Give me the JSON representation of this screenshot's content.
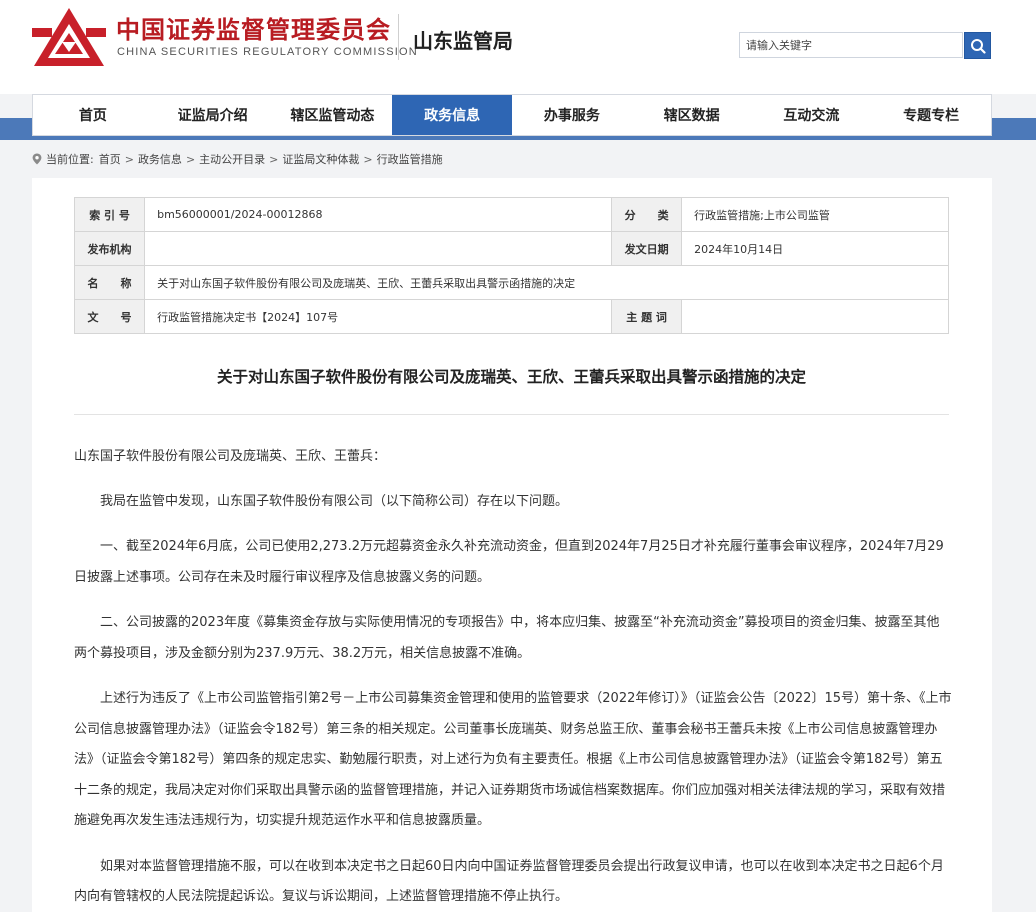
{
  "header": {
    "org_cn": "中国证券监督管理委员会",
    "org_en": "CHINA SECURITIES REGULATORY COMMISSION",
    "bureau": "山东监管局",
    "brand_color": "#b81c22",
    "accent_color": "#2e66b4"
  },
  "search": {
    "placeholder": "请输入关键字",
    "icon": "search-icon"
  },
  "nav": {
    "items": [
      "首页",
      "证监局介绍",
      "辖区监管动态",
      "政务信息",
      "办事服务",
      "辖区数据",
      "互动交流",
      "专题专栏"
    ],
    "active": "政务信息"
  },
  "breadcrumb": {
    "prefix": "当前位置:",
    "items": [
      "首页",
      "政务信息",
      "主动公开目录",
      "证监局文种体裁",
      "行政监管措施"
    ],
    "separator": ">"
  },
  "meta": {
    "index_label": "索 引 号",
    "index_value": "bm56000001/2024-00012868",
    "category_label": "分　　类",
    "category_value": "行政监管措施;上市公司监管",
    "issuer_label": "发布机构",
    "issuer_value": "",
    "date_label": "发文日期",
    "date_value": "2024年10月14日",
    "name_label": "名　　称",
    "name_value": "关于对山东国子软件股份有限公司及庞瑞英、王欣、王蕾兵采取出具警示函措施的决定",
    "docno_label": "文　　号",
    "docno_value": "行政监管措施决定书【2024】107号",
    "keyword_label": "主 题 词",
    "keyword_value": ""
  },
  "document": {
    "title": "关于对山东国子软件股份有限公司及庞瑞英、王欣、王蕾兵采取出具警示函措施的决定",
    "addressee": "山东国子软件股份有限公司及庞瑞英、王欣、王蕾兵：",
    "paragraphs": [
      "我局在监管中发现，山东国子软件股份有限公司（以下简称公司）存在以下问题。",
      "一、截至2024年6月底，公司已使用2,273.2万元超募资金永久补充流动资金，但直到2024年7月25日才补充履行董事会审议程序，2024年7月29日披露上述事项。公司存在未及时履行审议程序及信息披露义务的问题。",
      "二、公司披露的2023年度《募集资金存放与实际使用情况的专项报告》中，将本应归集、披露至“补充流动资金”募投项目的资金归集、披露至其他两个募投项目，涉及金额分别为237.9万元、38.2万元，相关信息披露不准确。",
      "上述行为违反了《上市公司监管指引第2号－上市公司募集资金管理和使用的监管要求（2022年修订）》（证监会公告〔2022〕15号）第十条、《上市公司信息披露管理办法》（证监会令182号）第三条的相关规定。公司董事长庞瑞英、财务总监王欣、董事会秘书王蕾兵未按《上市公司信息披露管理办法》（证监会令第182号）第四条的规定忠实、勤勉履行职责，对上述行为负有主要责任。根据《上市公司信息披露管理办法》（证监会令第182号）第五十二条的规定，我局决定对你们采取出具警示函的监督管理措施，并记入证券期货市场诚信档案数据库。你们应加强对相关法律法规的学习，采取有效措施避免再次发生违法违规行为，切实提升规范运作水平和信息披露质量。",
      "如果对本监督管理措施不服，可以在收到本决定书之日起60日内向中国证券监督管理委员会提出行政复议申请，也可以在收到本决定书之日起6个月内向有管辖权的人民法院提起诉讼。复议与诉讼期间，上述监督管理措施不停止执行。"
    ]
  }
}
